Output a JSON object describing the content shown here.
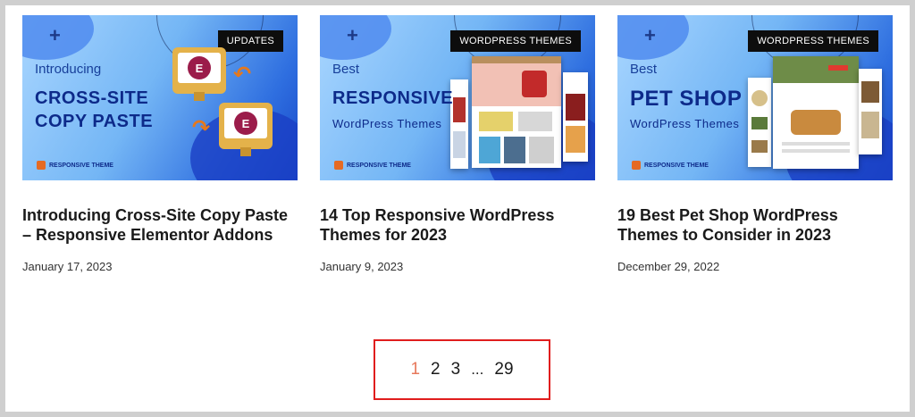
{
  "posts": [
    {
      "badge": "UPDATES",
      "thumb_line1": "Introducing",
      "thumb_line2": "CROSS-SITE",
      "thumb_line3": "COPY PASTE",
      "thumb_brand": "RESPONSIVE THEME",
      "title": "Introducing Cross-Site Copy Paste – Responsive Elementor Addons",
      "date": "January 17, 2023"
    },
    {
      "badge": "WORDPRESS THEMES",
      "thumb_line1": "Best",
      "thumb_line2": "RESPONSIVE",
      "thumb_line3": "WordPress Themes",
      "thumb_brand": "RESPONSIVE THEME",
      "title": "14 Top Responsive WordPress Themes for 2023",
      "date": "January 9, 2023"
    },
    {
      "badge": "WORDPRESS THEMES",
      "thumb_line1": "Best",
      "thumb_line2": "PET SHOP",
      "thumb_line3": "WordPress Themes",
      "thumb_brand": "RESPONSIVE THEME",
      "title": "19 Best Pet Shop WordPress Themes to Consider in 2023",
      "date": "December 29, 2022"
    }
  ],
  "pagination": {
    "pages": [
      "1",
      "2",
      "3"
    ],
    "ellipsis": "...",
    "last": "29",
    "current": "1"
  },
  "colors": {
    "accent_current_page": "#e7785b",
    "highlight_border": "#e01d1d",
    "badge_bg": "#0d0d0d"
  }
}
